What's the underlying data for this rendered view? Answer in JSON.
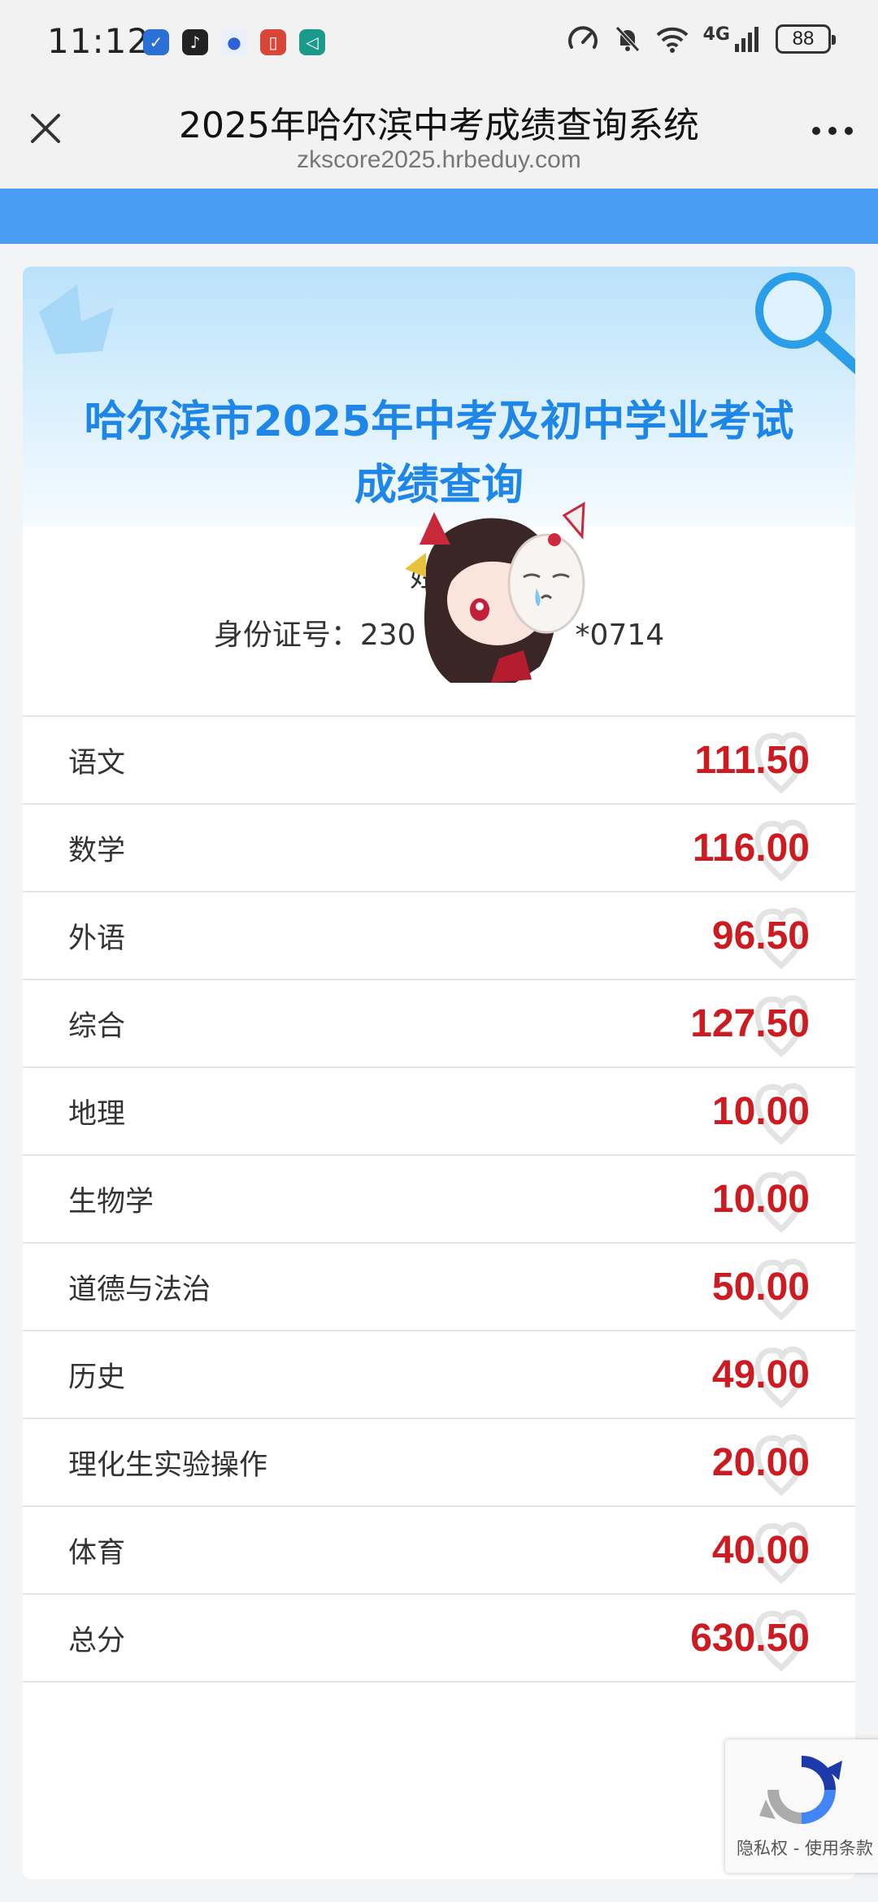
{
  "status_bar": {
    "time": "11:12",
    "network": "4G",
    "battery": "88",
    "apps": [
      "shield-app-icon",
      "music-app-icon",
      "baidu-app-icon",
      "book-app-icon",
      "play-app-icon"
    ]
  },
  "browser": {
    "title": "2025年哈尔滨中考成绩查询系统",
    "url": "zkscore2025.hrbeduy.com",
    "close_icon": "close-icon",
    "more_icon": "more-icon"
  },
  "card": {
    "heading_line1": "哈尔滨市2025年中考及初中学业考试",
    "heading_line2": "成绩查询",
    "name_label": "姓名",
    "id_label": "身份证号：",
    "id_prefix": "230",
    "id_suffix": "*0714"
  },
  "scores": [
    {
      "subject": "语文",
      "score": "111.50"
    },
    {
      "subject": "数学",
      "score": "116.00"
    },
    {
      "subject": "外语",
      "score": "96.50"
    },
    {
      "subject": "综合",
      "score": "127.50"
    },
    {
      "subject": "地理",
      "score": "10.00"
    },
    {
      "subject": "生物学",
      "score": "10.00"
    },
    {
      "subject": "道德与法治",
      "score": "50.00"
    },
    {
      "subject": "历史",
      "score": "49.00"
    },
    {
      "subject": "理化生实验操作",
      "score": "20.00"
    },
    {
      "subject": "体育",
      "score": "40.00"
    },
    {
      "subject": "总分",
      "score": "630.50"
    }
  ],
  "recaptcha": {
    "text": "隐私权 - 使用条款"
  },
  "colors": {
    "accent_blue": "#4a9cf2",
    "heading_blue": "#1e86e6",
    "score_red": "#cc1c22"
  }
}
